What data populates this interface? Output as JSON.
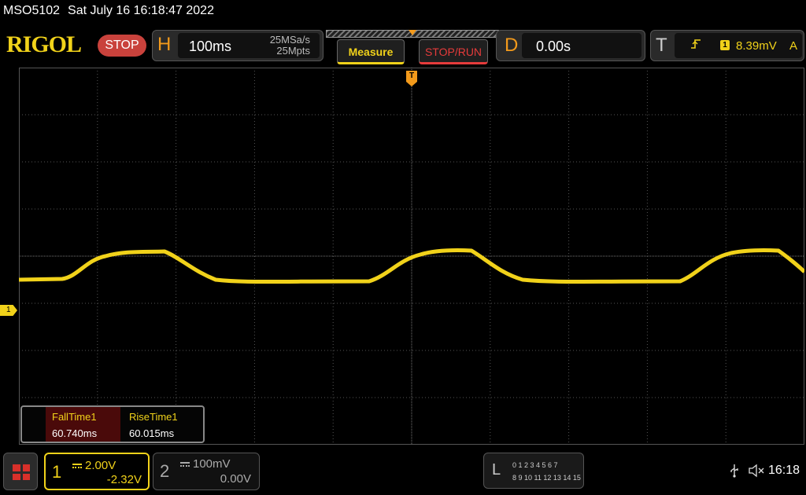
{
  "status": {
    "model": "MSO5102",
    "datetime": "Sat July 16 16:18:47 2022"
  },
  "brand": {
    "logo_text": "RIGOL",
    "run_state": "STOP"
  },
  "horizontal": {
    "label": "H",
    "timebase": "100ms",
    "sample_rate": "25MSa/s",
    "memory_depth": "25Mpts"
  },
  "buttons": {
    "measure": "Measure",
    "stop_run": "STOP/RUN"
  },
  "delay": {
    "label": "D",
    "value": "0.00s"
  },
  "trigger": {
    "label": "T",
    "edge_icon": "rising-edge-icon",
    "source": "1",
    "level": "8.39mV",
    "mode": "A",
    "position_flag": "T"
  },
  "channel_marker": "1",
  "measurements": [
    {
      "name": "FallTime1",
      "value": "60.740ms"
    },
    {
      "name": "RiseTime1",
      "value": "60.015ms"
    }
  ],
  "channels": {
    "ch1": {
      "number": "1",
      "scale": "2.00V",
      "offset": "-2.32V",
      "color": "#f1d21a"
    },
    "ch2": {
      "number": "2",
      "scale": "100mV",
      "offset": "0.00V",
      "color": "#aaaaaa"
    }
  },
  "logic": {
    "label": "L",
    "row1": "0 1 2 3   4 5 6 7",
    "row2": "8  9 10 11  12 13 14 15"
  },
  "system": {
    "clock": "16:18",
    "usb_icon": "usb-icon",
    "sound_icon": "speaker-muted-icon"
  },
  "colors": {
    "ch1_trace": "#f1d21a",
    "accent_orange": "#f39a1b",
    "stop_red": "#c9423c"
  }
}
